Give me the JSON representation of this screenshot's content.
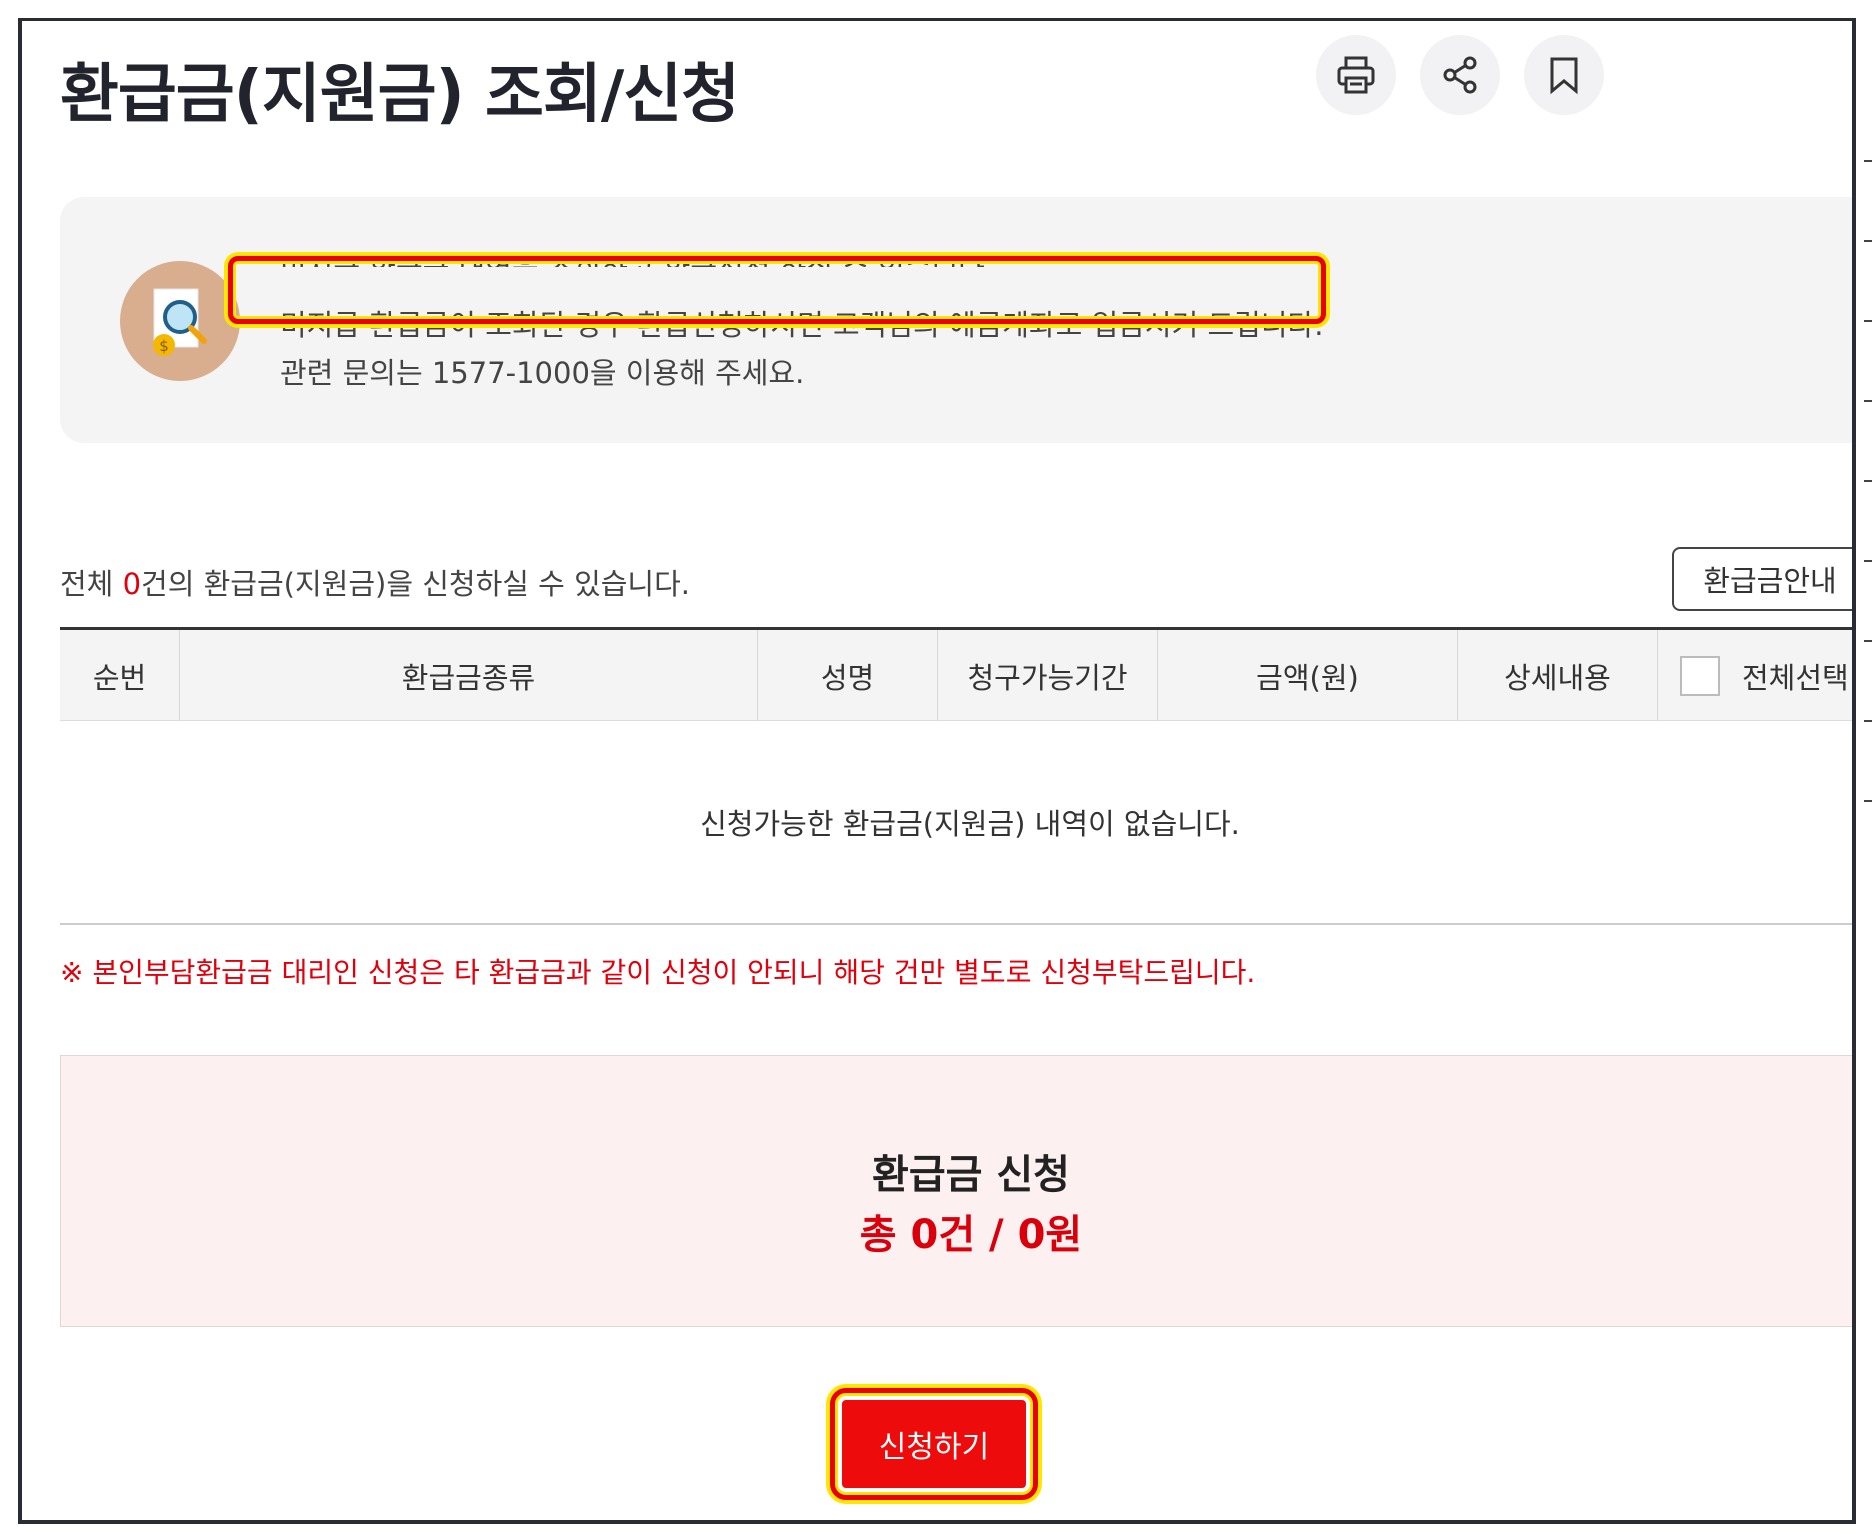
{
  "page": {
    "title": "환급금(지원금) 조회/신청"
  },
  "toolbar": {
    "print_icon": "print-icon",
    "share_icon": "share-icon",
    "bookmark_icon": "bookmark-icon"
  },
  "info": {
    "icon": "search-document-icon",
    "line1": "미지급 환급금 내역을 조회하고 환급신청 하실 수 있습니다.",
    "line2": "미지급 환급금이 조회된 경우 환급신청하시면 고객님의 예금계좌로 입금시켜 드립니다.",
    "line3": "관련 문의는 1577-1000을 이용해 주세요."
  },
  "count": {
    "prefix": "전체 ",
    "value": "0",
    "suffix": "건의 환급금(지원금)을 신청하실 수 있습니다."
  },
  "guide_button": "환급금안내",
  "table": {
    "columns": [
      "순번",
      "환급금종류",
      "성명",
      "청구가능기간",
      "금액(원)",
      "상세내용",
      "전체선택"
    ],
    "empty_message": "신청가능한 환급금(지원금) 내역이 없습니다."
  },
  "notice": "※ 본인부담환급금 대리인 신청은 타 환급금과 같이 신청이 안되니 해당 건만 별도로 신청부탁드립니다.",
  "summary": {
    "title": "환급금 신청",
    "total": "총 0건 / 0원"
  },
  "apply_button": "신청하기",
  "colors": {
    "accent_red": "#e0000c",
    "highlight_yellow": "#ffe600"
  }
}
